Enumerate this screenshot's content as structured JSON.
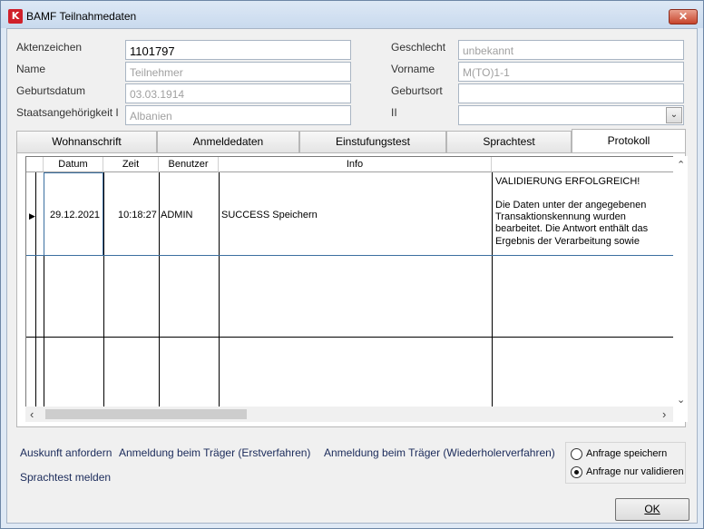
{
  "window": {
    "title": "BAMF Teilnahmedaten",
    "icon_letter": "K",
    "close_label": "✕"
  },
  "form": {
    "aktenzeichen": {
      "label": "Aktenzeichen",
      "value": "1101797"
    },
    "name": {
      "label": "Name",
      "value": "Teilnehmer"
    },
    "geburtsdatum": {
      "label": "Geburtsdatum",
      "value": "03.03.1914"
    },
    "staatsangehoerigkeit": {
      "label": "Staatsangehörigkeit I",
      "value": "Albanien"
    },
    "geschlecht": {
      "label": "Geschlecht",
      "value": "unbekannt"
    },
    "vorname": {
      "label": "Vorname",
      "value": "M(TO)1-1"
    },
    "geburtsort": {
      "label": "Geburtsort",
      "value": ""
    },
    "staatsangehoerigkeit2": {
      "label": "II",
      "value": ""
    },
    "combo_arrow": "⌄"
  },
  "tabs": [
    "Wohnanschrift",
    "Anmeldedaten",
    "Einstufungstest",
    "Sprachtest",
    "Protokoll"
  ],
  "active_tab": "Protokoll",
  "protocol": {
    "columns": [
      "Datum",
      "Zeit",
      "Benutzer",
      "Info"
    ],
    "rows": [
      {
        "datum": "29.12.2021",
        "zeit": "10:18:27",
        "benutzer": "ADMIN",
        "info": "SUCCESS Speichern",
        "detail_title": "VALIDIERUNG ERFOLGREICH!",
        "detail_text": "Die Daten unter der angegebenen Transaktionskennung wurden bearbeitet. Die Antwort enthält das Ergebnis der Verarbeitung sowie"
      }
    ],
    "row_indicator": "▶",
    "scroll_up": "⌃",
    "scroll_down": "⌄",
    "scroll_left": "‹",
    "scroll_right": "›"
  },
  "actions": {
    "auskunft": "Auskunft anfordern",
    "anmeldung_erst": "Anmeldung beim Träger (Erstverfahren)",
    "anmeldung_wieder": "Anmeldung beim Träger (Wiederholerverfahren)",
    "sprachtest": "Sprachtest melden"
  },
  "mode": {
    "options": [
      "Anfrage speichern",
      "Anfrage nur validieren"
    ],
    "selected": "Anfrage nur validieren"
  },
  "ok_label": "OK"
}
